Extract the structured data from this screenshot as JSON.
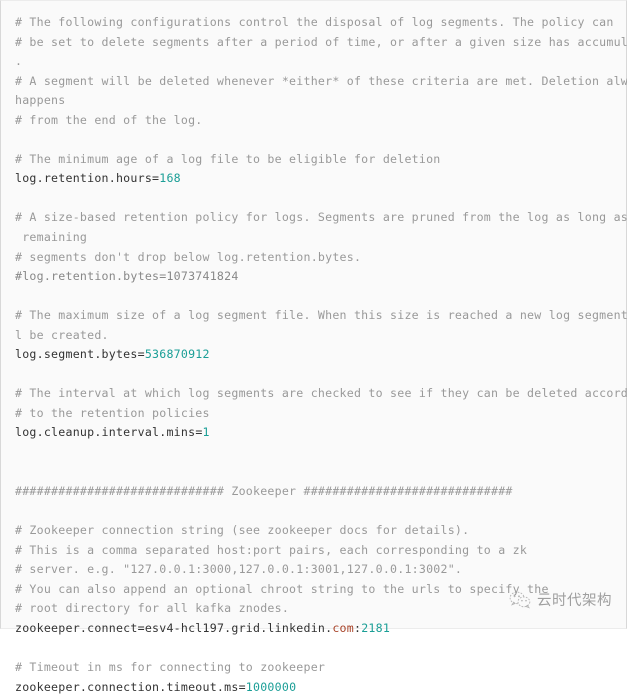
{
  "document": {
    "kind": "code-block",
    "language": "properties",
    "filename_implied": "server.properties",
    "colors": {
      "background": "#fafafa",
      "comment": "#999999",
      "commented_property": "#888888",
      "property_key": "#333333",
      "numeric_value": "#1a9e96",
      "domain_token": "#a8442a",
      "border": "#d8d8d8"
    }
  },
  "lines": [
    {
      "id": "l1",
      "type": "comment",
      "text": "# The following configurations control the disposal of log segments. The policy can"
    },
    {
      "id": "l2",
      "type": "comment",
      "text": "# be set to delete segments after a period of time, or after a given size has accumulated"
    },
    {
      "id": "l3",
      "type": "comment",
      "text": "."
    },
    {
      "id": "l4",
      "type": "comment",
      "text": "# A segment will be deleted whenever *either* of these criteria are met. Deletion always"
    },
    {
      "id": "l5",
      "type": "comment",
      "text": "happens"
    },
    {
      "id": "l6",
      "type": "comment",
      "text": "# from the end of the log."
    },
    {
      "id": "l7",
      "type": "blank",
      "text": ""
    },
    {
      "id": "l8",
      "type": "comment",
      "text": "# The minimum age of a log file to be eligible for deletion"
    },
    {
      "id": "l9",
      "type": "property",
      "key": "log.retention.hours",
      "value": "168"
    },
    {
      "id": "l10",
      "type": "blank",
      "text": ""
    },
    {
      "id": "l11",
      "type": "comment",
      "text": "# A size-based retention policy for logs. Segments are pruned from the log as long as the"
    },
    {
      "id": "l12",
      "type": "comment",
      "text": " remaining"
    },
    {
      "id": "l13",
      "type": "comment",
      "text": "# segments don't drop below log.retention.bytes."
    },
    {
      "id": "l14",
      "type": "commented-property",
      "text": "#log.retention.bytes=1073741824"
    },
    {
      "id": "l15",
      "type": "blank",
      "text": ""
    },
    {
      "id": "l16",
      "type": "comment",
      "text": "# The maximum size of a log segment file. When this size is reached a new log segment wil"
    },
    {
      "id": "l17",
      "type": "comment",
      "text": "l be created."
    },
    {
      "id": "l18",
      "type": "property",
      "key": "log.segment.bytes",
      "value": "536870912"
    },
    {
      "id": "l19",
      "type": "blank",
      "text": ""
    },
    {
      "id": "l20",
      "type": "comment",
      "text": "# The interval at which log segments are checked to see if they can be deleted according"
    },
    {
      "id": "l21",
      "type": "comment",
      "text": "# to the retention policies"
    },
    {
      "id": "l22",
      "type": "property",
      "key": "log.cleanup.interval.mins",
      "value": "1"
    },
    {
      "id": "l23",
      "type": "blank",
      "text": ""
    },
    {
      "id": "l24",
      "type": "blank",
      "text": ""
    },
    {
      "id": "l25",
      "type": "comment",
      "text": "############################# Zookeeper #############################"
    },
    {
      "id": "l26",
      "type": "blank",
      "text": ""
    },
    {
      "id": "l27",
      "type": "comment",
      "text": "# Zookeeper connection string (see zookeeper docs for details)."
    },
    {
      "id": "l28",
      "type": "comment",
      "text": "# This is a comma separated host:port pairs, each corresponding to a zk"
    },
    {
      "id": "l29",
      "type": "comment",
      "text": "# server. e.g. \"127.0.0.1:3000,127.0.0.1:3001,127.0.0.1:3002\"."
    },
    {
      "id": "l30",
      "type": "comment",
      "text": "# You can also append an optional chroot string to the urls to specify the"
    },
    {
      "id": "l31",
      "type": "comment",
      "text": "# root directory for all kafka znodes."
    },
    {
      "id": "l32",
      "type": "property-host",
      "key": "zookeeper.connect",
      "host": "esv4-hcl197.grid.linkedin.",
      "domain": "com",
      "colon": ":",
      "port": "2181"
    },
    {
      "id": "l33",
      "type": "blank",
      "text": ""
    },
    {
      "id": "l34",
      "type": "comment",
      "text": "# Timeout in ms for connecting to zookeeper"
    },
    {
      "id": "l35",
      "type": "property",
      "key": "zookeeper.connection.timeout.ms",
      "value": "1000000"
    }
  ],
  "watermark": {
    "icon": "wechat-icon",
    "text": "云时代架构"
  }
}
